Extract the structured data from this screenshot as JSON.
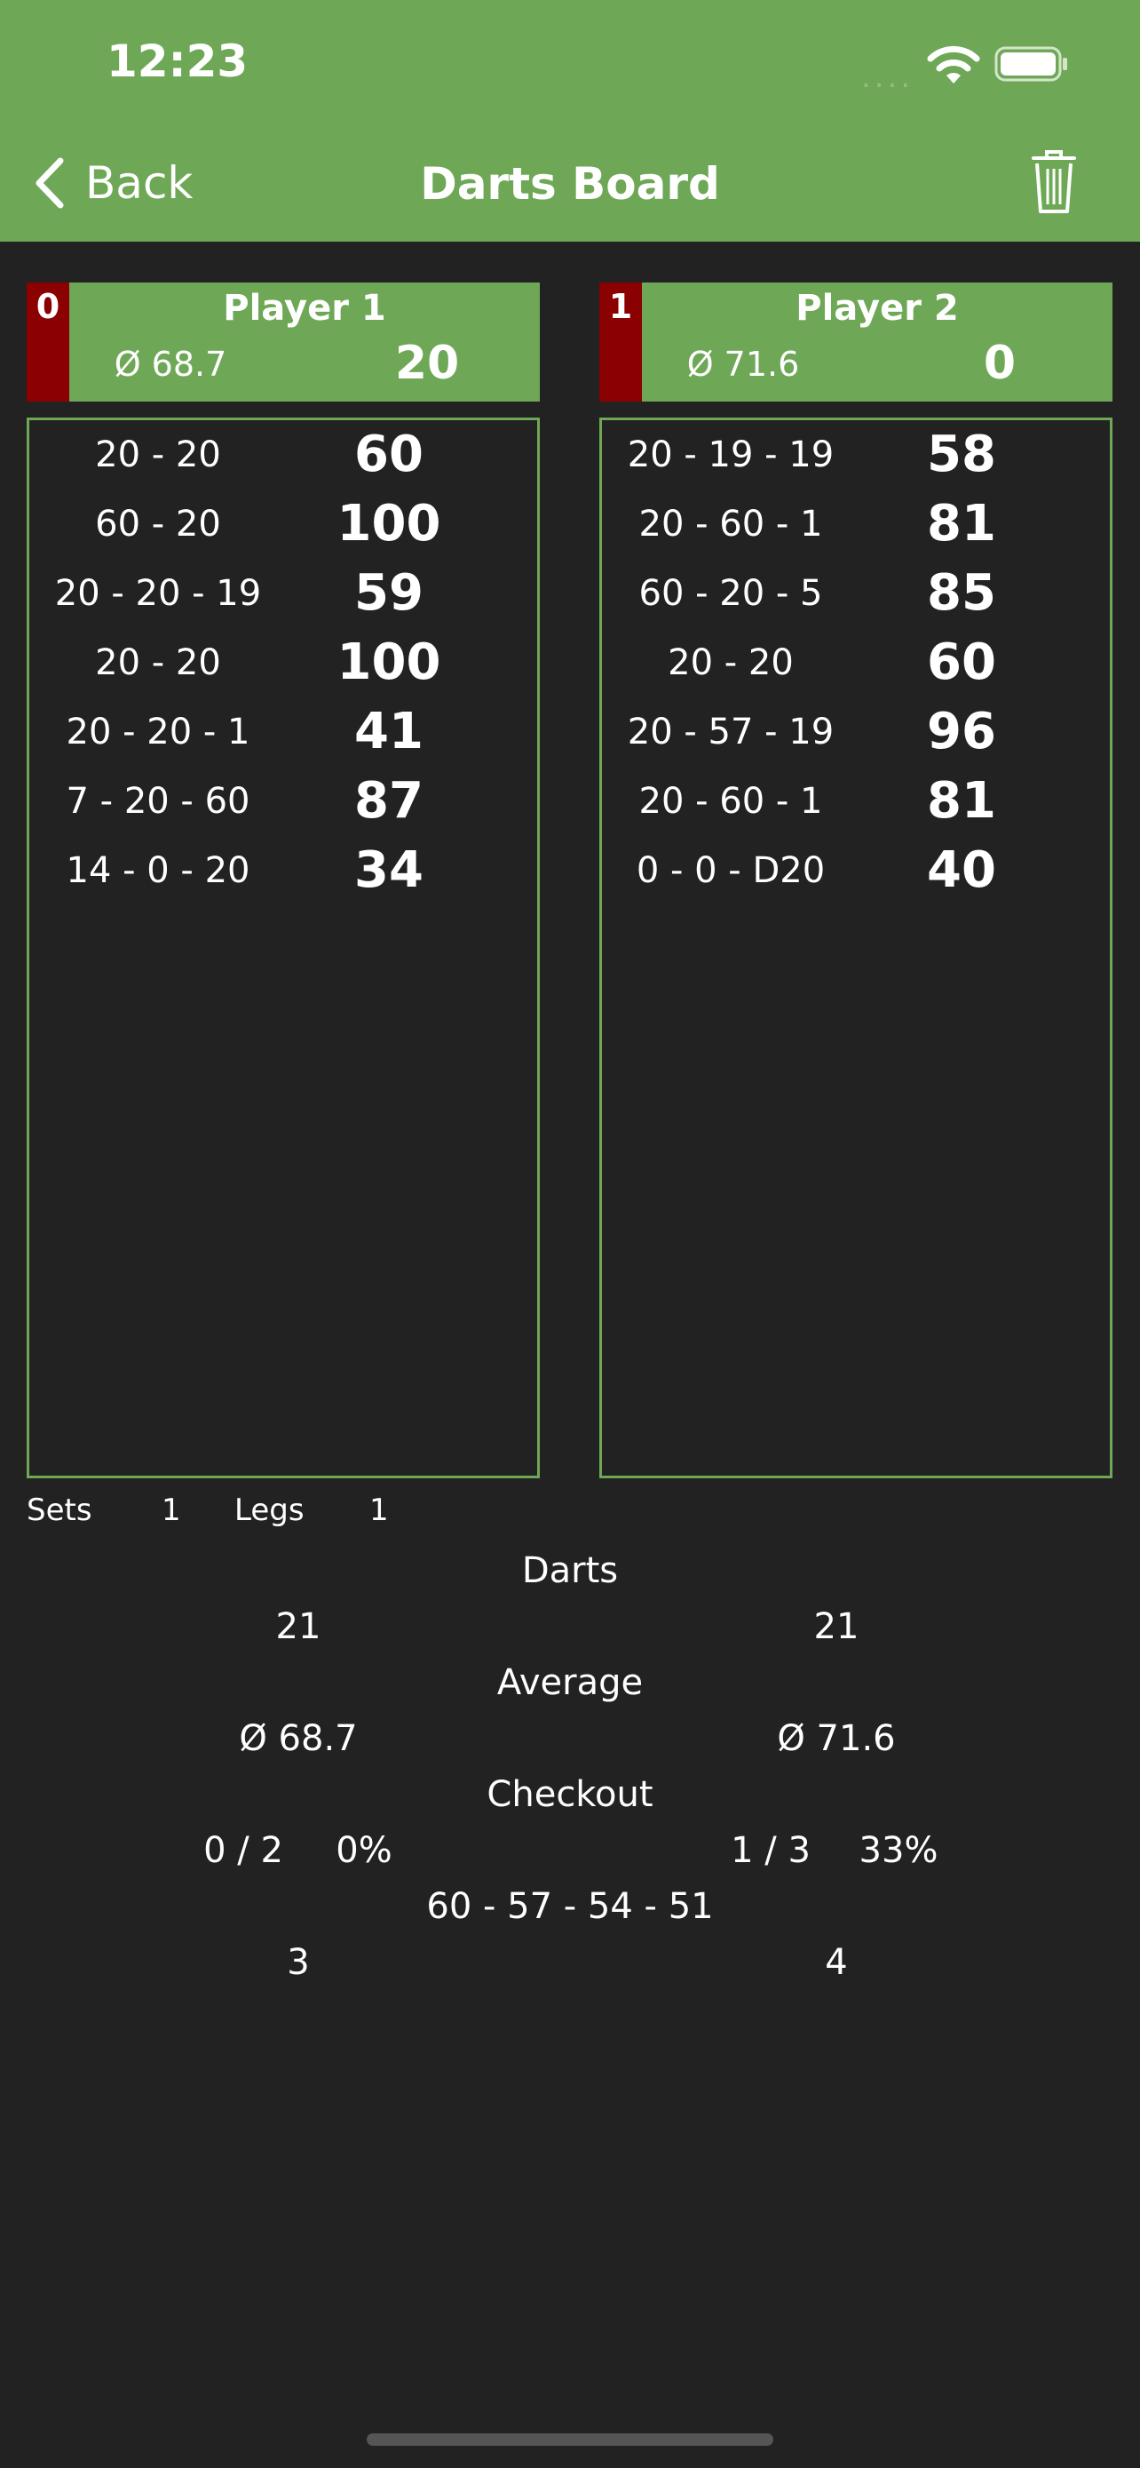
{
  "status_bar": {
    "time": "12:23",
    "signal_dots": "....",
    "icons": [
      "wifi-icon",
      "battery-icon"
    ]
  },
  "nav": {
    "back_label": "Back",
    "title": "Darts Board",
    "back_icon": "chevron-left-icon",
    "trash_icon": "trash-icon"
  },
  "players": [
    {
      "legs_won": "0",
      "name": "Player 1",
      "average": "Ø 68.7",
      "remaining": "20",
      "throws": [
        {
          "darts": "20 - 20",
          "score": "60"
        },
        {
          "darts": "60 - 20",
          "score": "100"
        },
        {
          "darts": "20 - 20 - 19",
          "score": "59"
        },
        {
          "darts": "20 - 20",
          "score": "100"
        },
        {
          "darts": "20 - 20 - 1",
          "score": "41"
        },
        {
          "darts": "7 - 20 - 60",
          "score": "87"
        },
        {
          "darts": "14 - 0 - 20",
          "score": "34"
        }
      ]
    },
    {
      "legs_won": "1",
      "name": "Player 2",
      "average": "Ø 71.6",
      "remaining": "0",
      "throws": [
        {
          "darts": "20 - 19 - 19",
          "score": "58"
        },
        {
          "darts": "20 - 60 - 1",
          "score": "81"
        },
        {
          "darts": "60 - 20 - 5",
          "score": "85"
        },
        {
          "darts": "20 - 20",
          "score": "60"
        },
        {
          "darts": "20 - 57 - 19",
          "score": "96"
        },
        {
          "darts": "20 - 60 - 1",
          "score": "81"
        },
        {
          "darts": "0 - 0 - D20",
          "score": "40"
        }
      ]
    }
  ],
  "match": {
    "sets_label": "Sets",
    "sets_value": "1",
    "legs_label": "Legs",
    "legs_value": "1"
  },
  "stats": {
    "darts": {
      "label": "Darts",
      "p1": "21",
      "p2": "21"
    },
    "average": {
      "label": "Average",
      "p1": "Ø 68.7",
      "p2": "Ø 71.6"
    },
    "checkout": {
      "label": "Checkout",
      "p1_ratio": "0 / 2",
      "p1_pct": "0%",
      "p2_ratio": "1 / 3",
      "p2_pct": "33%"
    },
    "high_scores": {
      "label": "60 - 57 - 54 - 51",
      "p1": "3",
      "p2": "4"
    }
  },
  "colors": {
    "header": "#6ea856",
    "background": "#222222",
    "legs_badge": "#8b0000",
    "text": "#ffffff"
  }
}
